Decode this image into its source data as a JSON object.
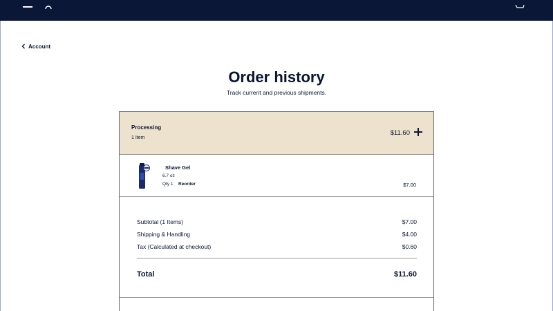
{
  "nav": {
    "back_label": "Account"
  },
  "page": {
    "title": "Order history",
    "subtitle": "Track current and previous shipments."
  },
  "order": {
    "status": "Processing",
    "item_count": "1 Item",
    "header_total": "$11.60",
    "items": [
      {
        "name": "Shave Gel",
        "size": "6.7 oz",
        "qty": "Qty 1",
        "reorder_label": "Reorder",
        "price": "$7.00"
      }
    ],
    "summary": {
      "subtotal_label": "Subtotal (1 Items)",
      "subtotal_value": "$7.00",
      "shipping_label": "Shipping & Handling",
      "shipping_value": "$4.00",
      "tax_label": "Tax (Calculated at checkout)",
      "tax_value": "$0.60",
      "total_label": "Total",
      "total_value": "$11.60"
    }
  },
  "colors": {
    "topbar": "#0b1736",
    "header_bg": "#ede2cd",
    "text": "#0a1531"
  }
}
